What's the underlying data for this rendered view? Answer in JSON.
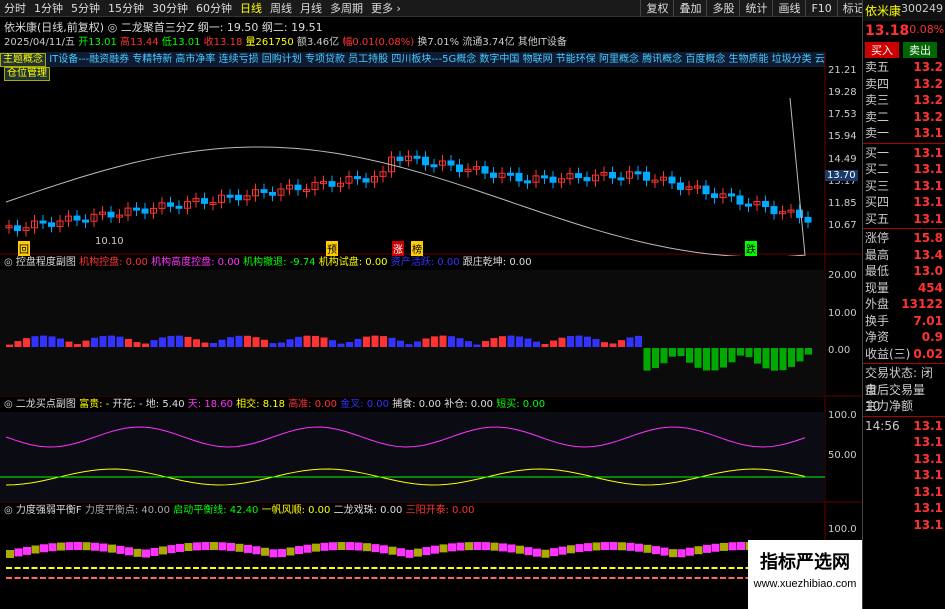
{
  "toolbar": {
    "periods": [
      "分时",
      "1分钟",
      "5分钟",
      "15分钟",
      "30分钟",
      "60分钟",
      "日线",
      "周线",
      "月线",
      "多周期",
      "更多 ›"
    ],
    "active": "日线",
    "right": [
      "复权",
      "叠加",
      "多股",
      "统计",
      "画线",
      "F10",
      "标记",
      "+自选",
      "返回"
    ]
  },
  "header": {
    "stock": "依米康(日线,前复权)",
    "indicator": "◎ 二龙聚首三分Z 纲一: 19.50 纲二: 19.51",
    "date": "2025/04/11/五",
    "open": "开13.01",
    "high": "高13.44",
    "low": "低13.01",
    "close": "收13.18",
    "vol": "量261750",
    "amount": "额3.46亿",
    "change": "幅0.01(0.08%)",
    "turnover": "换7.01%",
    "float": "流通3.74亿",
    "category": "其他IT设备"
  },
  "concepts": {
    "tag1": "主题概念",
    "tag2": "仓位管理",
    "text": "IT设备---融资融券 专精特新 高市净率 连续亏损 回购计划 专项贷款 员工持股 四川板块---5G概念 数字中国 物联网 节能环保 阿里概念 腾讯概念 百度概念 生物质能 垃圾分类 云计算 边缘计算"
  },
  "main_chart": {
    "y_ticks": [
      "21.21",
      "19.28",
      "17.53",
      "15.94",
      "14.49",
      "13.17",
      "11.85",
      "10.67"
    ],
    "price_flag": "13.70",
    "low_label": "10.10",
    "markers": [
      "回",
      "预",
      "涨",
      "榜",
      "跌"
    ],
    "colors": {
      "up": "#f33",
      "down": "#0af",
      "midline": "#ccc"
    }
  },
  "panel1": {
    "title": "◎ 控盘程度副图",
    "items": [
      "机构控盘: 0.00",
      "机构高度控盘: 0.00",
      "机构撤退: -9.74",
      "机构试盘: 0.00",
      "资产活跃: 0.00",
      "跟庄乾坤: 0.00"
    ],
    "y_ticks": [
      "20.00",
      "10.00",
      "0.00"
    ]
  },
  "panel2": {
    "title": "◎ 二龙买点副图",
    "items": [
      "富贵: -",
      "开花: -",
      "地: 5.40",
      "天: 18.60",
      "相交: 8.18",
      "高准: 0.00",
      "金叉: 0.00",
      "捕食: 0.00",
      "补仓: 0.00",
      "短买: 0.00"
    ],
    "y_ticks": [
      "100.0",
      "50.00"
    ]
  },
  "panel3": {
    "title": "◎ 力度强弱平衡F",
    "items": [
      "力度平衡点: 40.00",
      "启动平衡线: 42.40",
      "一帆风顺: 0.00",
      "二龙戏珠: 0.00",
      "三阳开泰: 0.00"
    ],
    "y_ticks": [
      "100.0",
      "0.00"
    ]
  },
  "quote": {
    "name": "依米康",
    "code": "300249",
    "price": "13.18",
    "pct": "0.08%",
    "buy": "买入",
    "sell": "卖出",
    "asks": [
      {
        "l": "卖五",
        "v": "13.2"
      },
      {
        "l": "卖四",
        "v": "13.2"
      },
      {
        "l": "卖三",
        "v": "13.2"
      },
      {
        "l": "卖二",
        "v": "13.2"
      },
      {
        "l": "卖一",
        "v": "13.1"
      }
    ],
    "bids": [
      {
        "l": "买一",
        "v": "13.1"
      },
      {
        "l": "买二",
        "v": "13.1"
      },
      {
        "l": "买三",
        "v": "13.1"
      },
      {
        "l": "买四",
        "v": "13.1"
      },
      {
        "l": "买五",
        "v": "13.1"
      }
    ],
    "stats": [
      {
        "l": "涨停",
        "v": "15.8"
      },
      {
        "l": "最高",
        "v": "13.4"
      },
      {
        "l": "最低",
        "v": "13.0"
      },
      {
        "l": "现量",
        "v": "454"
      },
      {
        "l": "外盘",
        "v": "13122"
      },
      {
        "l": "换手",
        "v": "7.01"
      },
      {
        "l": "净资",
        "v": "0.9"
      },
      {
        "l": "收益(三)",
        "v": "0.02"
      }
    ],
    "trade_status": "交易状态: 闭市",
    "after_hours": "盘后交易量 10",
    "net_flow": "主力净额",
    "ticks": [
      {
        "t": "14:56",
        "v": "13.1"
      },
      {
        "t": "",
        "v": "13.1"
      },
      {
        "t": "",
        "v": "13.1"
      },
      {
        "t": "",
        "v": "13.1"
      },
      {
        "t": "",
        "v": "13.1"
      },
      {
        "t": "",
        "v": "13.1"
      },
      {
        "t": "",
        "v": "13.1"
      }
    ]
  },
  "watermark": {
    "title": "指标严选网",
    "url": "www.xuezhibiao.com"
  }
}
